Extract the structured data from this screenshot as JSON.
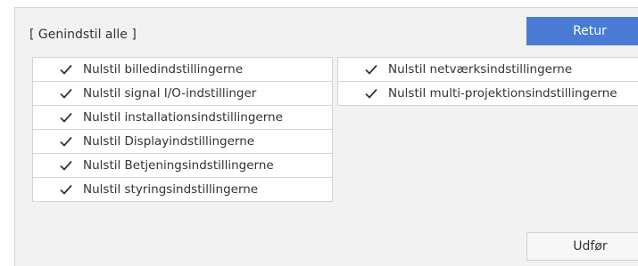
{
  "colors": {
    "accent": "#4a7bd4",
    "panel_bg": "#f2f2f2",
    "text": "#333333"
  },
  "dialog": {
    "title": "[ Genindstil alle ]",
    "return_label": "Retur",
    "execute_label": "Udfør"
  },
  "left_items": [
    {
      "label": "Nulstil billedindstillingerne",
      "checked": true,
      "icon": "checkmark-icon"
    },
    {
      "label": "Nulstil signal I/O-indstillinger",
      "checked": true,
      "icon": "checkmark-icon"
    },
    {
      "label": "Nulstil installationsindstillingerne",
      "checked": true,
      "icon": "checkmark-icon"
    },
    {
      "label": "Nulstil Displayindstillingerne",
      "checked": true,
      "icon": "checkmark-icon"
    },
    {
      "label": "Nulstil Betjeningsindstillingerne",
      "checked": true,
      "icon": "checkmark-icon"
    },
    {
      "label": "Nulstil styringsindstillingerne",
      "checked": true,
      "icon": "checkmark-icon"
    }
  ],
  "right_items": [
    {
      "label": "Nulstil netværksindstillingerne",
      "checked": true,
      "icon": "checkmark-icon"
    },
    {
      "label": "Nulstil multi-projektionsindstillingerne",
      "checked": true,
      "icon": "checkmark-icon"
    }
  ]
}
